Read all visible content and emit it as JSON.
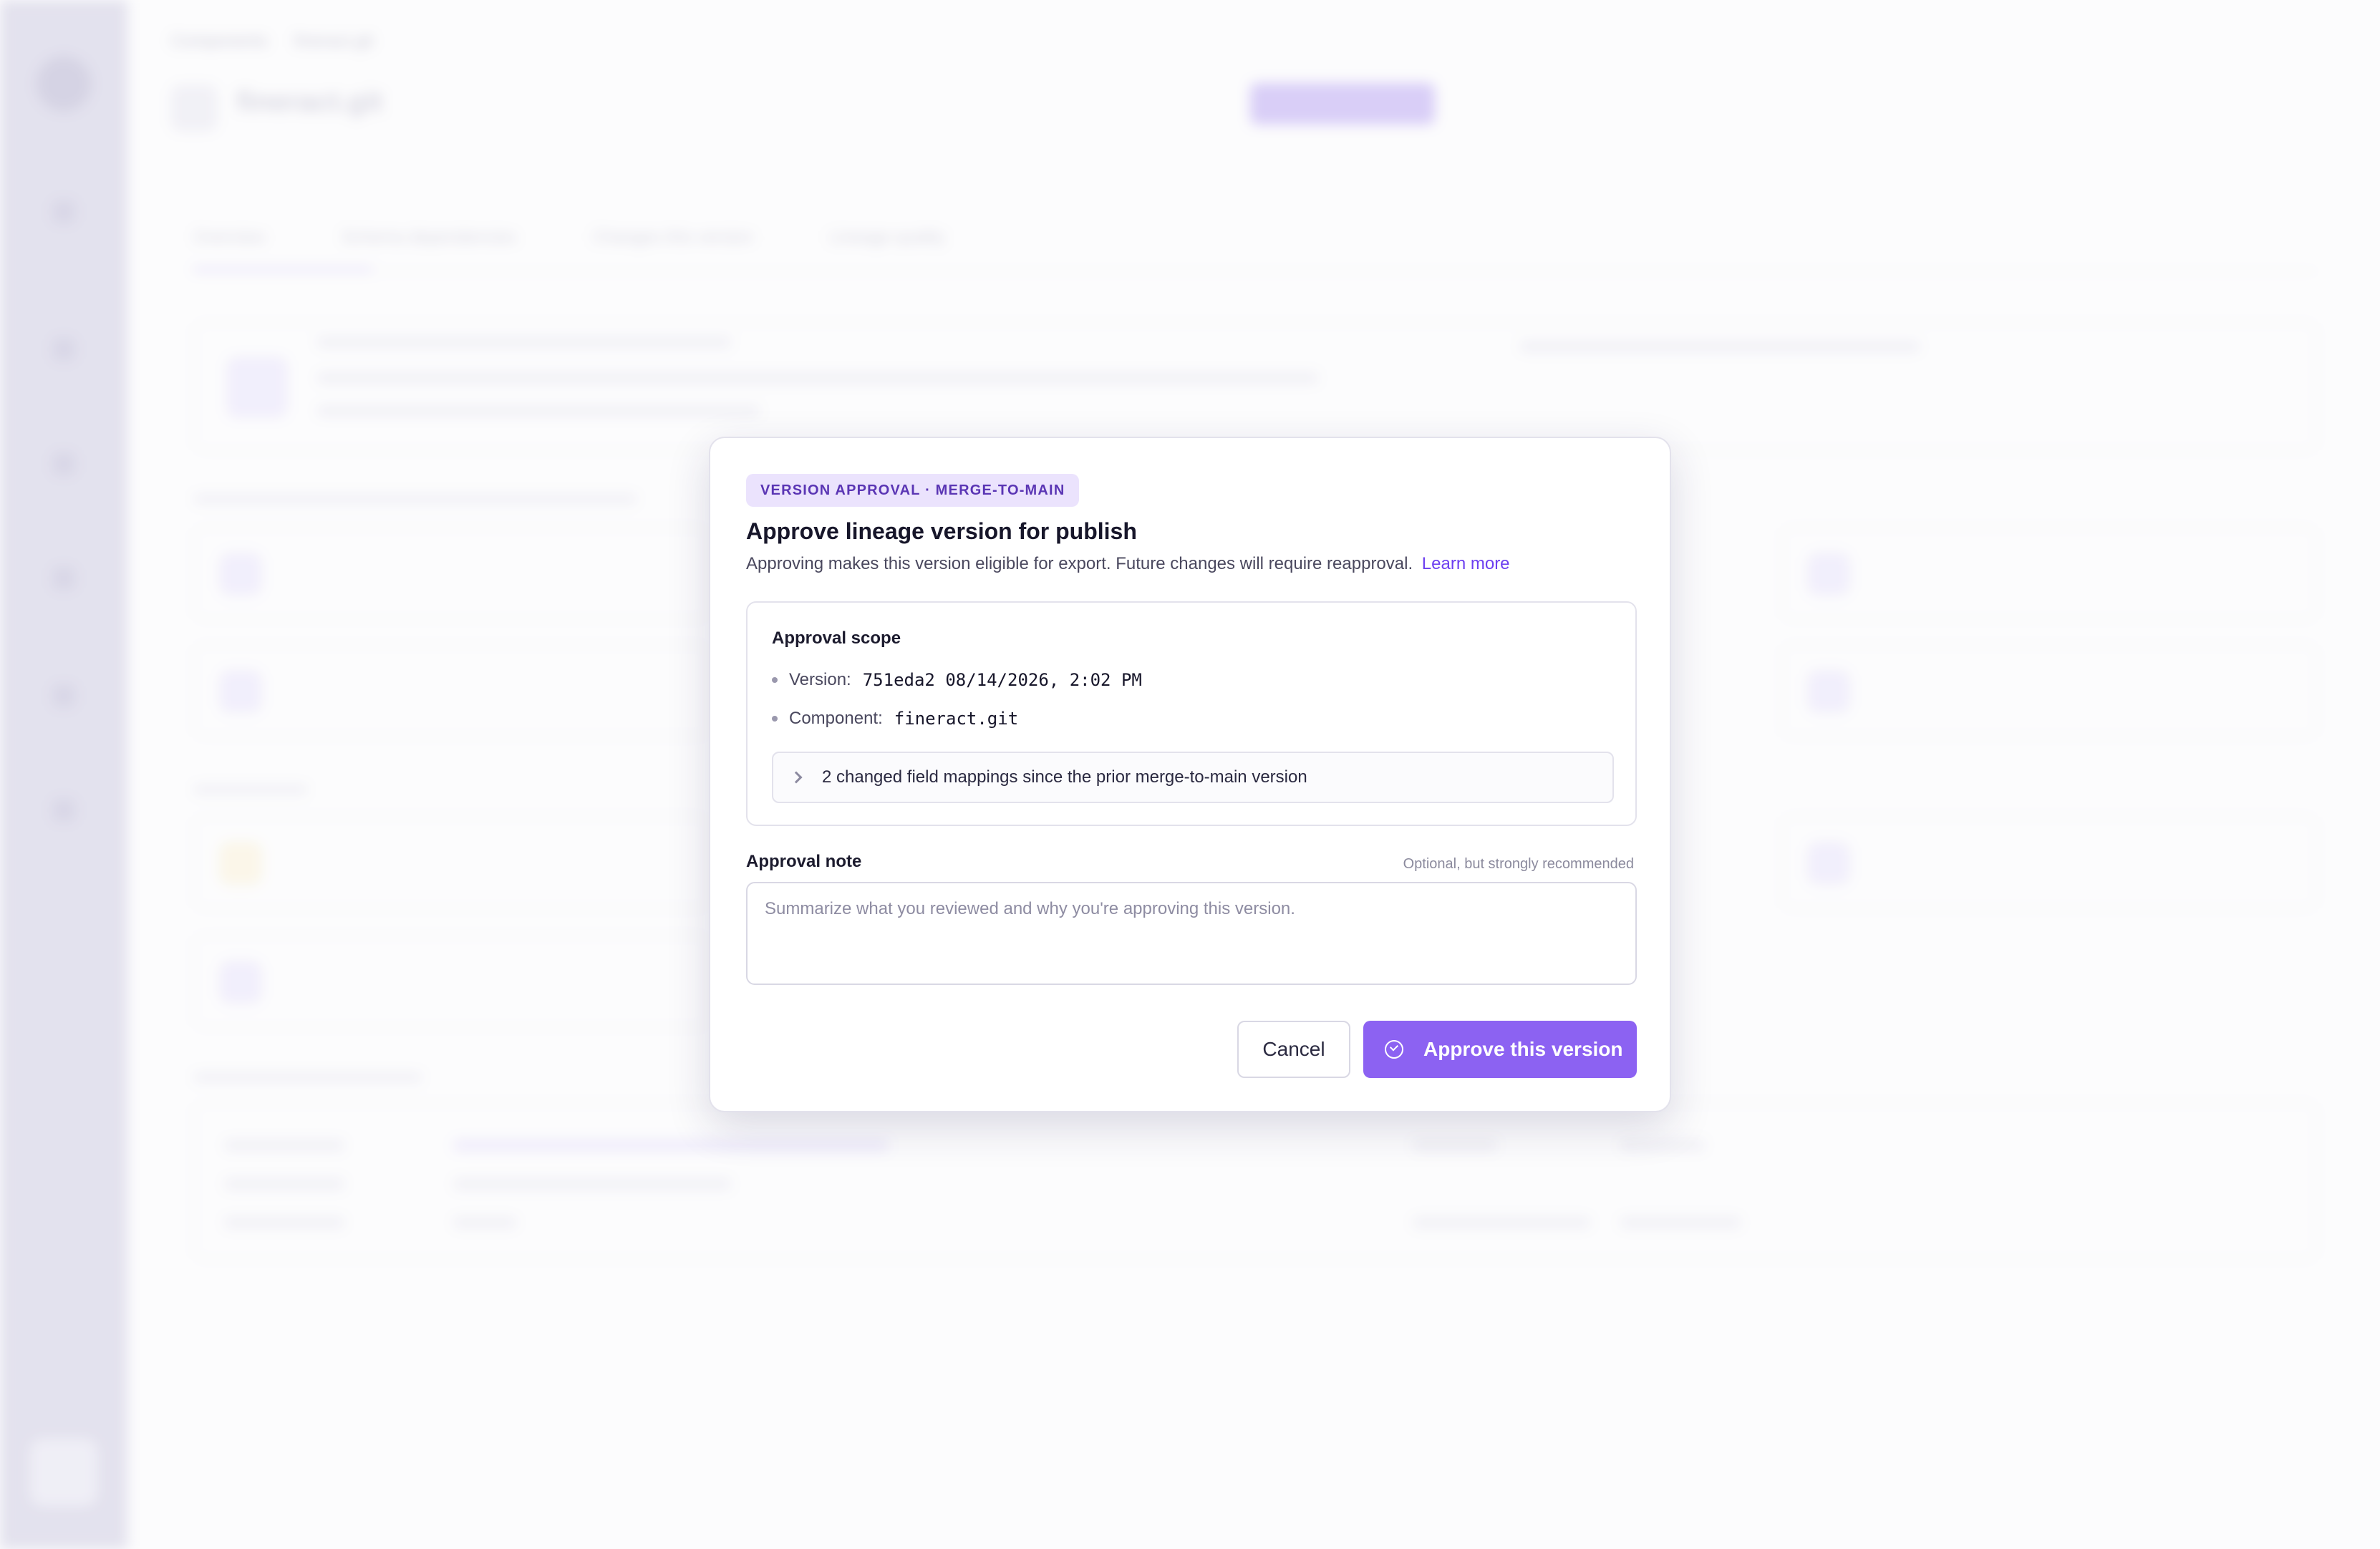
{
  "background": {
    "breadcrumbs": [
      "Components",
      "fineract.git"
    ],
    "repo_title": "fineract.git",
    "tabs": [
      "Overview",
      "Schema dependencies",
      "Changes this version",
      "Lineage quality"
    ]
  },
  "modal": {
    "badge": "VERSION APPROVAL · MERGE-TO-MAIN",
    "title": "Approve lineage version for publish",
    "subtitle": "Approving makes this version eligible for export. Future changes will require reapproval.",
    "learn_more": "Learn more",
    "scope": {
      "title": "Approval scope",
      "version_label": "Version:",
      "version_value": "751eda2 08/14/2026, 2:02 PM",
      "component_label": "Component:",
      "component_value": "fineract.git",
      "changes_text": "2 changed field mappings since the prior merge-to-main version"
    },
    "note": {
      "label": "Approval note",
      "hint": "Optional, but strongly recommended",
      "value": "",
      "placeholder": "Summarize what you reviewed and why you're approving this version."
    },
    "cancel_label": "Cancel",
    "approve_label": "Approve this version"
  },
  "colors": {
    "accent": "#8c62f2",
    "badge_bg": "#ebe3fd",
    "badge_text": "#5a35b4",
    "link": "#6d3ff0"
  },
  "icons": {
    "expand": "chevron-right-icon",
    "approve": "check-circle-icon"
  }
}
